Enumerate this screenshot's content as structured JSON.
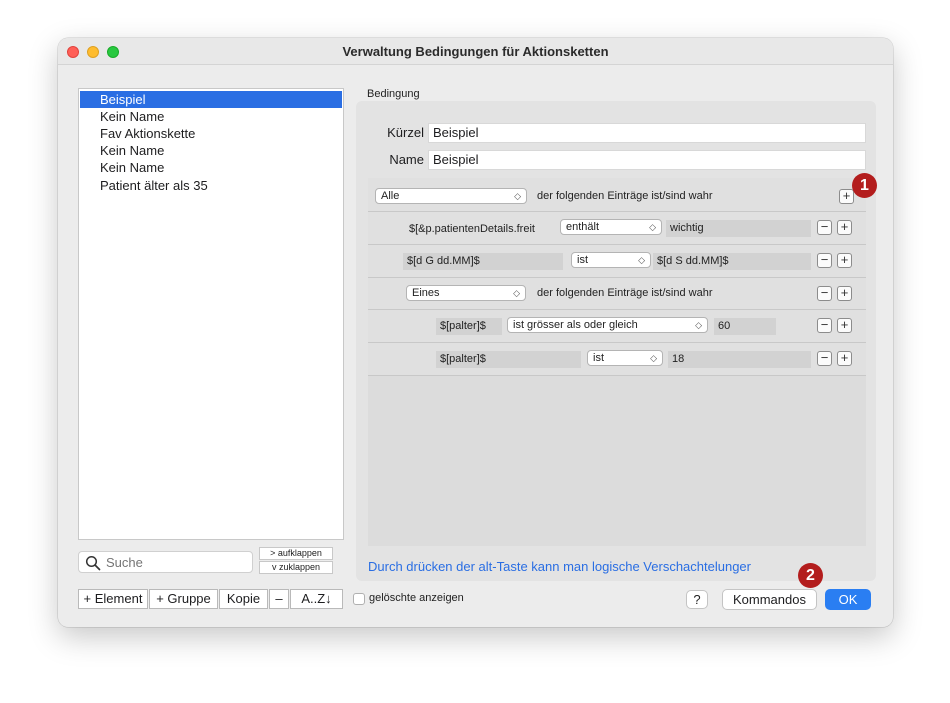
{
  "window": {
    "title": "Verwaltung Bedingungen für Aktionsketten"
  },
  "list": {
    "items": [
      "Beispiel",
      "Kein Name",
      "Fav Aktionskette",
      "Kein Name",
      "Kein Name",
      "Patient älter als 35"
    ],
    "selected": 0
  },
  "search": {
    "placeholder": "Suche"
  },
  "tree_buttons": {
    "expand": "> aufklappen",
    "collapse": "v  zuklappen"
  },
  "toolbar": {
    "element": "+ Element",
    "group": "+ Gruppe",
    "copy": "Kopie",
    "remove": "–",
    "sort": "A..Z↓"
  },
  "condition": {
    "section_label": "Bedingung",
    "kuerzel_label": "Kürzel",
    "kuerzel_value": "Beispiel",
    "name_label": "Name",
    "name_value": "Beispiel"
  },
  "rules": {
    "root_mode": "Alle",
    "root_text": "der folgenden Einträge ist/sind wahr",
    "r1": {
      "field": "$[&p.patientenDetails.freit",
      "op": "enthält",
      "value": "wichtig"
    },
    "r2": {
      "field": "$[d G dd.MM]$",
      "op": "ist",
      "value": "$[d S dd.MM]$"
    },
    "group_mode": "Eines",
    "group_text": "der folgenden Einträge ist/sind wahr",
    "r3": {
      "field": "$[palter]$",
      "op": "ist grösser als oder gleich",
      "value": "60"
    },
    "r4": {
      "field": "$[palter]$",
      "op": "ist",
      "value": "18"
    }
  },
  "hint": "Durch drücken der alt-Taste kann man logische Verschachtelunger",
  "footer": {
    "show_deleted": "gelöschte anzeigen",
    "help": "?",
    "commands": "Kommandos",
    "ok": "OK"
  },
  "badges": {
    "one": "1",
    "two": "2"
  },
  "colors": {
    "accent": "#2a6ee3",
    "ok_button": "#2a7ef2",
    "badge": "#b31d1d"
  }
}
